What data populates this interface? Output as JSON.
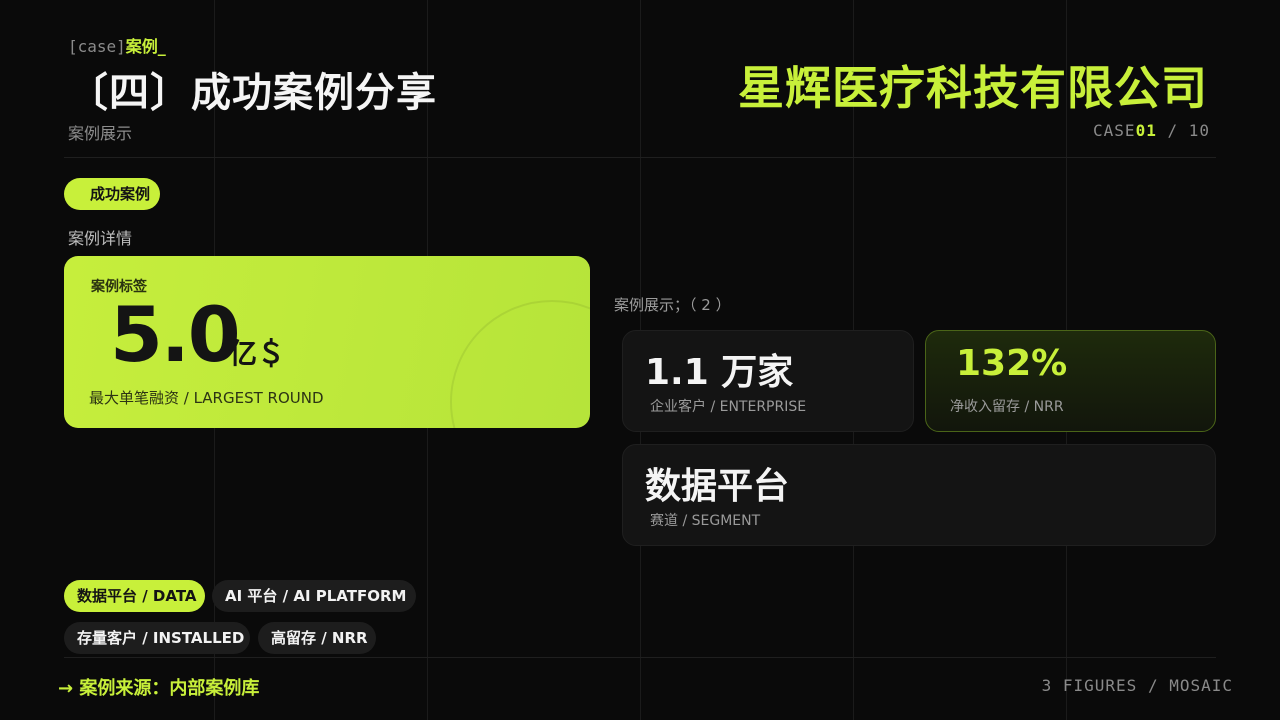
{
  "header": {
    "eyebrow_tag": "[case]",
    "eyebrow_accent": "案例_",
    "title": "〔四〕成功案例分享",
    "subtitle": "案例展示",
    "company": "星辉医疗科技有限公司",
    "counter_prefix": "CASE",
    "counter_current": "01",
    "counter_total": " / 10"
  },
  "badge": "成功案例",
  "detail_label": "案例详情",
  "hero": {
    "label": "案例标签",
    "value": "5.0",
    "unit": "亿＄",
    "caption": "最大单笔融资 / LARGEST ROUND"
  },
  "showcase_label": "案例展示；（ 2 ）",
  "cards": [
    {
      "value": "1.1 万家",
      "caption": "企业客户 / ENTERPRISE"
    },
    {
      "value": "132%",
      "caption": "净收入留存 / NRR"
    },
    {
      "value": "数据平台",
      "caption": "赛道 / SEGMENT"
    }
  ],
  "tags": [
    "数据平台 / DATA",
    "AI 平台 / AI PLATFORM",
    "存量客户 / INSTALLED",
    "高留存 / NRR"
  ],
  "footer": {
    "source": "→ 案例来源：内部案例库",
    "right": "3 FIGURES / MOSAIC"
  },
  "colors": {
    "accent": "#c8f03a",
    "background": "#0a0a0a"
  }
}
